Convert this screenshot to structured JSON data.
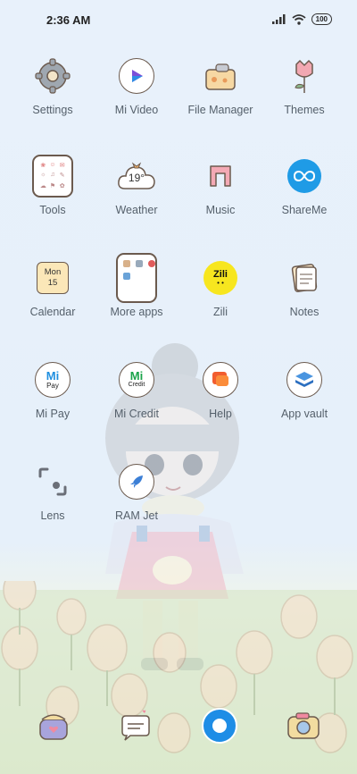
{
  "status": {
    "time": "2:36 AM",
    "battery": "100"
  },
  "apps": [
    {
      "label": "Settings"
    },
    {
      "label": "Mi Video"
    },
    {
      "label": "File Manager"
    },
    {
      "label": "Themes"
    },
    {
      "label": "Tools"
    },
    {
      "label": "Weather"
    },
    {
      "label": "Music"
    },
    {
      "label": "ShareMe"
    },
    {
      "label": "Calendar"
    },
    {
      "label": "More apps"
    },
    {
      "label": "Zili"
    },
    {
      "label": "Notes"
    },
    {
      "label": "Mi Pay"
    },
    {
      "label": "Mi Credit"
    },
    {
      "label": "Help"
    },
    {
      "label": "App vault"
    },
    {
      "label": "Lens"
    },
    {
      "label": "RAM Jet"
    }
  ],
  "weather_temp": "19°",
  "calendar": {
    "month": "Mon",
    "day": "15"
  },
  "zili_text": "Zili",
  "mipay_text": "Pay",
  "micredit_text": "Credit",
  "dock": [
    "phone-icon",
    "messages-icon",
    "browser-icon",
    "camera-icon"
  ]
}
